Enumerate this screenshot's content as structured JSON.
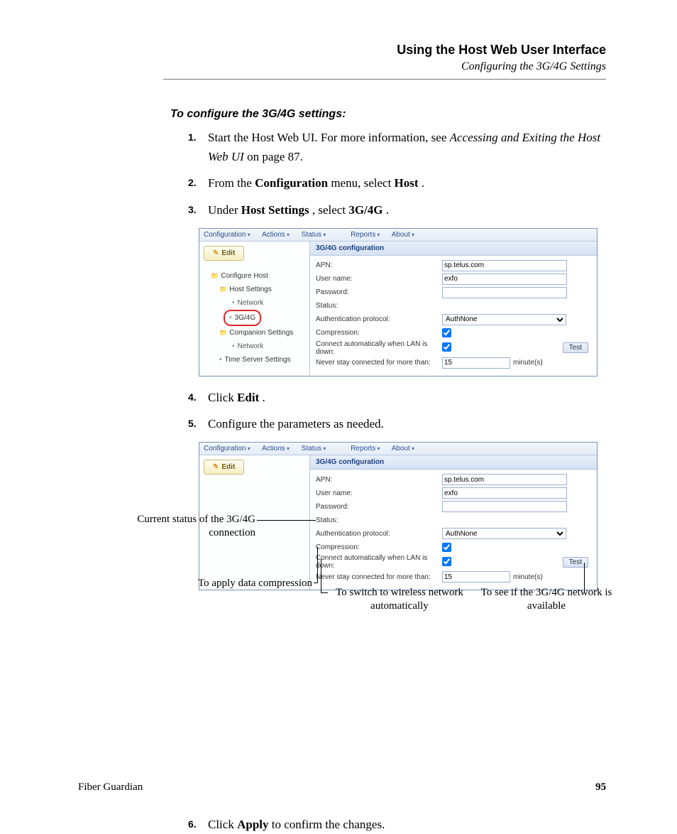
{
  "header": {
    "title": "Using the Host Web User Interface",
    "subtitle": "Configuring the 3G/4G Settings"
  },
  "section_heading": "To configure the 3G/4G settings:",
  "steps": {
    "s1": {
      "num": "1.",
      "t1": "Start the Host Web UI. For more information, see ",
      "em": "Accessing and Exiting the Host Web UI",
      "t2": " on page 87."
    },
    "s2": {
      "num": "2.",
      "t1": "From the ",
      "b1": "Configuration",
      "t2": " menu, select ",
      "b2": "Host",
      "t3": "."
    },
    "s3": {
      "num": "3.",
      "t1": "Under ",
      "b1": "Host Settings",
      "t2": ", select ",
      "b2": "3G/4G",
      "t3": "."
    },
    "s4": {
      "num": "4.",
      "t1": "Click ",
      "b1": "Edit",
      "t2": "."
    },
    "s5": {
      "num": "5.",
      "t1": "Configure the parameters as needed."
    },
    "s6": {
      "num": "6.",
      "t1": "Click ",
      "b1": "Apply",
      "t2": " to confirm the changes."
    }
  },
  "ui": {
    "menu": {
      "configuration": "Configuration",
      "actions": "Actions",
      "status": "Status",
      "reports": "Reports",
      "about": "About"
    },
    "edit_button": "Edit",
    "tree": {
      "root": "Configure Host",
      "host_settings": "Host Settings",
      "network1": "Network",
      "g34": "3G/4G",
      "companion": "Companion Settings",
      "network2": "Network",
      "time_server": "Time Server Settings"
    },
    "panel_title": "3G/4G configuration",
    "fields": {
      "apn": {
        "label": "APN:",
        "value": "sp.telus.com"
      },
      "user": {
        "label": "User name:",
        "value": "exfo"
      },
      "password": {
        "label": "Password:",
        "value": ""
      },
      "status": {
        "label": "Status:"
      },
      "auth": {
        "label": "Authentication protocol:",
        "value": "AuthNone"
      },
      "compression": {
        "label": "Compression:",
        "checked": true
      },
      "auto": {
        "label": "Connect automatically when LAN is down:",
        "checked": true
      },
      "never": {
        "label": "Never stay connected for more than:",
        "value": "15",
        "unit": "minute(s)"
      }
    },
    "test_button": "Test"
  },
  "callouts": {
    "status": "Current status of the 3G/4G connection",
    "compression": "To apply data compression",
    "auto": "To switch to wireless network automatically",
    "test": "To see if the 3G/4G network is available"
  },
  "footer": {
    "product": "Fiber Guardian",
    "page": "95"
  }
}
